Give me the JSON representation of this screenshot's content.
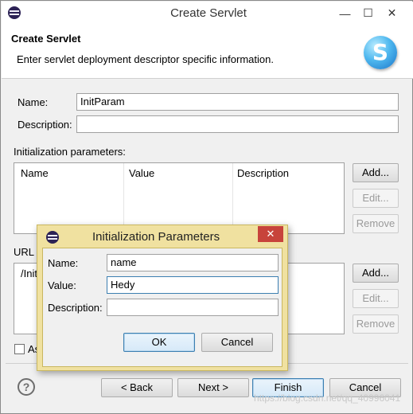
{
  "window": {
    "title": "Create Servlet",
    "minimize_label": "—",
    "maximize_label": "☐",
    "close_label": "✕"
  },
  "banner": {
    "title": "Create Servlet",
    "description": "Enter servlet deployment descriptor specific information.",
    "logo_letter": "S"
  },
  "form": {
    "name_label": "Name:",
    "name_value": "InitParam",
    "description_label": "Description:",
    "description_value": ""
  },
  "init_params": {
    "section_label": "Initialization parameters:",
    "columns": [
      "Name",
      "Value",
      "Description"
    ],
    "add_label": "Add...",
    "edit_label": "Edit...",
    "remove_label": "Remove"
  },
  "url_mappings": {
    "section_label": "URL m",
    "rows": [
      "/Init"
    ],
    "add_label": "Add...",
    "edit_label": "Edit...",
    "remove_label": "Remove"
  },
  "async_checkbox": {
    "label": "As",
    "checked": false
  },
  "footer": {
    "help_label": "?",
    "back_label": "< Back",
    "next_label": "Next >",
    "finish_label": "Finish",
    "cancel_label": "Cancel"
  },
  "dialog": {
    "title": "Initialization Parameters",
    "close_label": "✕",
    "name_label": "Name:",
    "name_value": "name",
    "value_label": "Value:",
    "value_value": "Hedy",
    "description_label": "Description:",
    "description_value": "",
    "ok_label": "OK",
    "cancel_label": "Cancel"
  },
  "watermark": "https://blog.csdn.net/qq_40996041"
}
